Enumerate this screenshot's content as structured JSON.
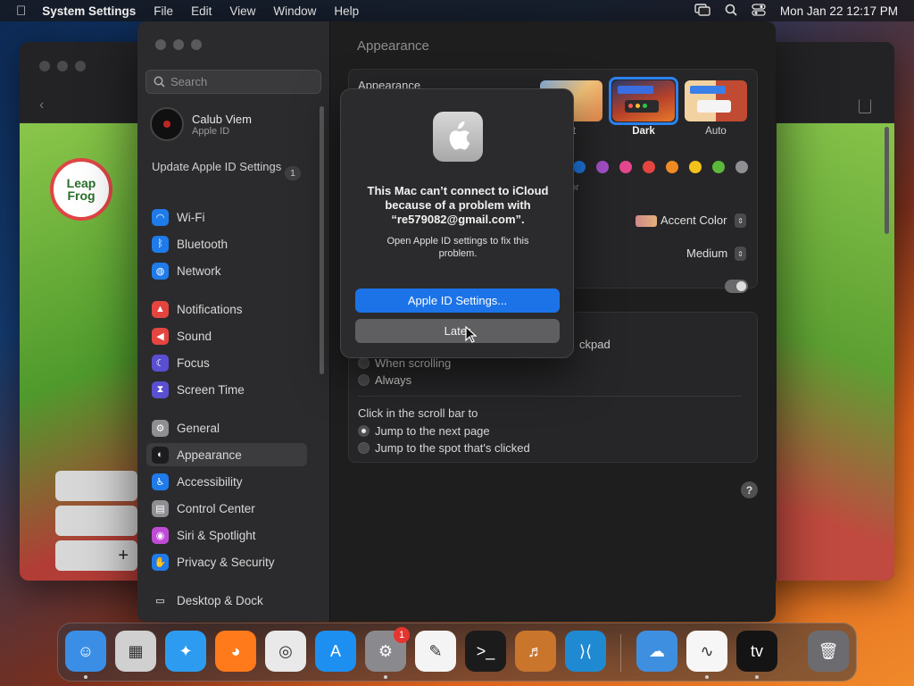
{
  "menubar": {
    "apple": "",
    "app_name": "System Settings",
    "menus": [
      "File",
      "Edit",
      "View",
      "Window",
      "Help"
    ],
    "clock": "Mon Jan 22  12:17 PM"
  },
  "bg_window": {
    "logo_text": "Leap Frog",
    "add_label": "+"
  },
  "window": {
    "title": "Appearance",
    "search_placeholder": "Search",
    "account": {
      "name": "Calub Viem",
      "subtitle": "Apple ID"
    },
    "update_notice": "Update Apple ID Settings",
    "update_badge": "1",
    "sidebar": [
      {
        "label": "Wi-Fi",
        "icon": "wifi-icon",
        "color": "#1f7bea",
        "glyph": "◠"
      },
      {
        "label": "Bluetooth",
        "icon": "bluetooth-icon",
        "color": "#1f7bea",
        "glyph": "ᛒ"
      },
      {
        "label": "Network",
        "icon": "globe-icon",
        "color": "#1f7bea",
        "glyph": "◍"
      },
      {
        "label": "Notifications",
        "icon": "bell-icon",
        "color": "#e5453f",
        "glyph": "▲"
      },
      {
        "label": "Sound",
        "icon": "speaker-icon",
        "color": "#e5453f",
        "glyph": "◀"
      },
      {
        "label": "Focus",
        "icon": "moon-icon",
        "color": "#5a4fd1",
        "glyph": "☾"
      },
      {
        "label": "Screen Time",
        "icon": "hourglass-icon",
        "color": "#5a4fd1",
        "glyph": "⧗"
      },
      {
        "label": "General",
        "icon": "gear-icon",
        "color": "#8e8e93",
        "glyph": "⚙"
      },
      {
        "label": "Appearance",
        "icon": "appearance-icon",
        "color": "#1c1c1e",
        "glyph": "◐",
        "selected": true
      },
      {
        "label": "Accessibility",
        "icon": "accessibility-icon",
        "color": "#1f7bea",
        "glyph": "♿"
      },
      {
        "label": "Control Center",
        "icon": "control-center-icon",
        "color": "#8e8e93",
        "glyph": "▤"
      },
      {
        "label": "Siri & Spotlight",
        "icon": "siri-icon",
        "color": "#c04bd6",
        "glyph": "◉"
      },
      {
        "label": "Privacy & Security",
        "icon": "hand-icon",
        "color": "#1f7bea",
        "glyph": "✋"
      },
      {
        "label": "Desktop & Dock",
        "icon": "dock-icon",
        "color": "#2c2c2e",
        "glyph": "▭"
      }
    ],
    "appearance_label": "Appearance",
    "appearance_options": [
      {
        "label": "Light",
        "visible_label": "nt"
      },
      {
        "label": "Dark",
        "selected": true
      },
      {
        "label": "Auto"
      }
    ],
    "accent_colors": [
      "#1f7bea",
      "#a550c8",
      "#e5478f",
      "#e5453f",
      "#f08a24",
      "#f5c21b",
      "#5cb83a",
      "#8e8e93"
    ],
    "accent_partial": "or",
    "highlight_color_value": "Accent Color",
    "highlight_swatch": "#d9a06a",
    "sidebar_icon_size_value": "Medium",
    "show_scrollbars_partial": "ckpad",
    "scroll_options": [
      "When scrolling",
      "Always"
    ],
    "click_scrollbar_label": "Click in the scroll bar to",
    "click_options": [
      "Jump to the next page",
      "Jump to the spot that's clicked"
    ],
    "help": "?"
  },
  "alert": {
    "title": "This Mac can’t connect to iCloud because of a problem with “re579082@gmail.com”.",
    "message": "Open Apple ID settings to fix this problem.",
    "primary_button": "Apple ID Settings...",
    "secondary_button": "Later"
  },
  "dock": {
    "apps": [
      {
        "name": "Finder",
        "icon": "finder-icon",
        "color": "#3a8ee6",
        "glyph": "☺",
        "running": true
      },
      {
        "name": "Launchpad",
        "icon": "launchpad-icon",
        "color": "#d0d0d0",
        "glyph": "▦"
      },
      {
        "name": "Safari",
        "icon": "safari-icon",
        "color": "#2d9cf0",
        "glyph": "✦"
      },
      {
        "name": "Firefox",
        "icon": "firefox-icon",
        "color": "#ff7a1a",
        "glyph": "◕"
      },
      {
        "name": "Chrome",
        "icon": "chrome-icon",
        "color": "#e9e9e9",
        "glyph": "◎"
      },
      {
        "name": "App Store",
        "icon": "app-store-icon",
        "color": "#1d8ff0",
        "glyph": "A"
      },
      {
        "name": "System Settings",
        "icon": "settings-icon",
        "color": "#8a8a8e",
        "glyph": "⚙",
        "badge": "1",
        "running": true
      },
      {
        "name": "TextEdit",
        "icon": "textedit-icon",
        "color": "#f4f4f4",
        "glyph": "✎"
      },
      {
        "name": "Terminal",
        "icon": "terminal-icon",
        "color": "#1b1b1b",
        "glyph": ">_"
      },
      {
        "name": "GarageBand",
        "icon": "garageband-icon",
        "color": "#c9762c",
        "glyph": "♬"
      },
      {
        "name": "Visual Studio Code",
        "icon": "vscode-icon",
        "color": "#1f8ad2",
        "glyph": "⟩⟨"
      },
      {
        "name": "Weather",
        "icon": "weather-icon",
        "color": "#3f8fe0",
        "glyph": "☁"
      },
      {
        "name": "Freeform",
        "icon": "freeform-icon",
        "color": "#f6f6f6",
        "glyph": "∿",
        "running": true
      },
      {
        "name": "Apple TV",
        "icon": "apple-tv-icon",
        "color": "#141414",
        "glyph": "tv",
        "running": true
      },
      {
        "name": "Trash",
        "icon": "trash-icon",
        "color": "#6c6c70",
        "glyph": "🗑"
      }
    ]
  }
}
